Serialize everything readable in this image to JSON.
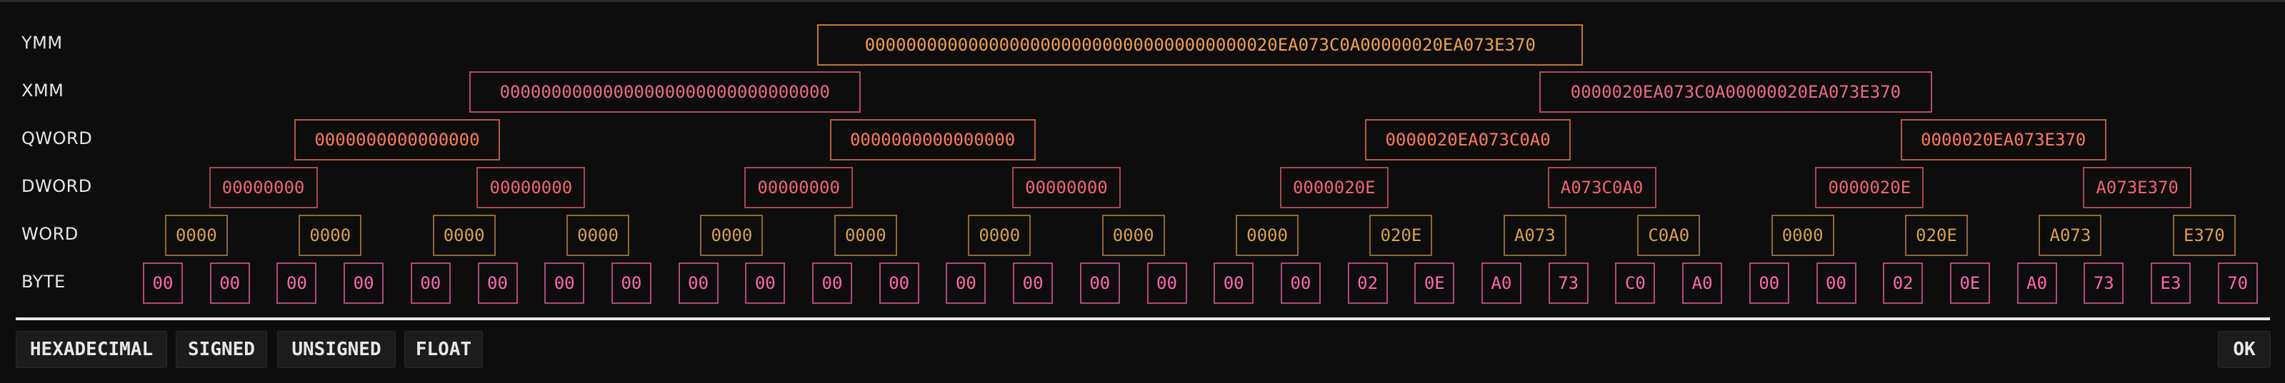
{
  "rows": {
    "ymm": {
      "label": "YMM",
      "values": [
        "0000000000000000000000000000000000000020EA073C0A00000020EA073E370"
      ]
    },
    "xmm": {
      "label": "XMM",
      "values": [
        "00000000000000000000000000000000",
        "0000020EA073C0A00000020EA073E370"
      ]
    },
    "qword": {
      "label": "QWORD",
      "values": [
        "0000000000000000",
        "0000000000000000",
        "0000020EA073C0A0",
        "0000020EA073E370"
      ]
    },
    "dword": {
      "label": "DWORD",
      "values": [
        "00000000",
        "00000000",
        "00000000",
        "00000000",
        "0000020E",
        "A073C0A0",
        "0000020E",
        "A073E370"
      ]
    },
    "word": {
      "label": "WORD",
      "values": [
        "0000",
        "0000",
        "0000",
        "0000",
        "0000",
        "0000",
        "0000",
        "0000",
        "0000",
        "020E",
        "A073",
        "C0A0",
        "0000",
        "020E",
        "A073",
        "E370"
      ]
    },
    "byte": {
      "label": "BYTE",
      "values": [
        "00",
        "00",
        "00",
        "00",
        "00",
        "00",
        "00",
        "00",
        "00",
        "00",
        "00",
        "00",
        "00",
        "00",
        "00",
        "00",
        "00",
        "00",
        "02",
        "0E",
        "A0",
        "73",
        "C0",
        "A0",
        "00",
        "00",
        "02",
        "0E",
        "A0",
        "73",
        "E3",
        "70"
      ]
    }
  },
  "buttons": {
    "hexadecimal": "HEXADECIMAL",
    "signed": "SIGNED",
    "unsigned": "UNSIGNED",
    "float": "FLOAT",
    "ok": "OK"
  },
  "colors": {
    "background": "#0d0d0d",
    "ymm": "#f0a14a",
    "xmm": "#ec6a86",
    "qword": "#ff7a5a",
    "dword": "#f26474",
    "word": "#d9a14a",
    "byte": "#ff69a8"
  }
}
